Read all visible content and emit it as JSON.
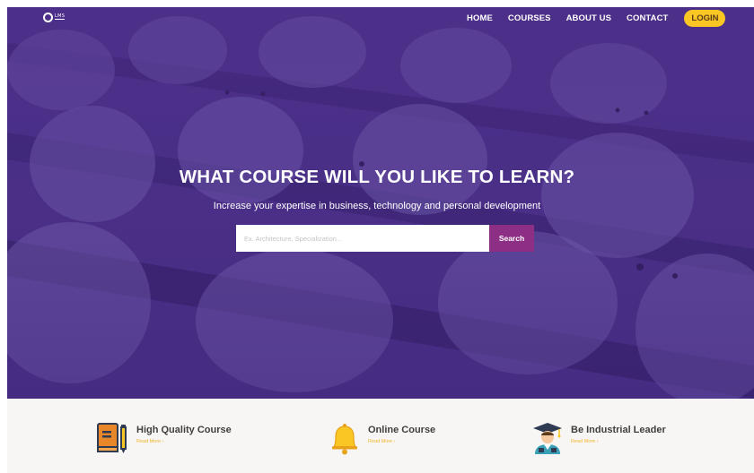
{
  "logo": {
    "text": "LMS",
    "icon": "logo-ring-icon"
  },
  "nav": {
    "items": [
      {
        "label": "HOME"
      },
      {
        "label": "COURSES"
      },
      {
        "label": "ABOUT US"
      },
      {
        "label": "CONTACT"
      }
    ],
    "login_label": "LOGIN"
  },
  "hero": {
    "title": "WHAT COURSE WILL YOU LIKE TO LEARN?",
    "subtitle": "Increase your expertise in business, technology and personal development",
    "search": {
      "placeholder": "Ex. Architecture, Specialization...",
      "value": "",
      "button_label": "Search"
    }
  },
  "features": [
    {
      "title": "High Quality Course",
      "link": "Read More ›",
      "icon": "book-pencil-icon"
    },
    {
      "title": "Online Course",
      "link": "Read More ›",
      "icon": "bell-icon"
    },
    {
      "title": "Be Industrial Leader",
      "link": "Read More ›",
      "icon": "graduate-icon"
    }
  ],
  "colors": {
    "hero_purple": "#4a2f86",
    "login_yellow": "#f9c624",
    "search_button": "#8e2f86",
    "feature_link": "#f0b429",
    "features_bg": "#f7f6f4"
  }
}
